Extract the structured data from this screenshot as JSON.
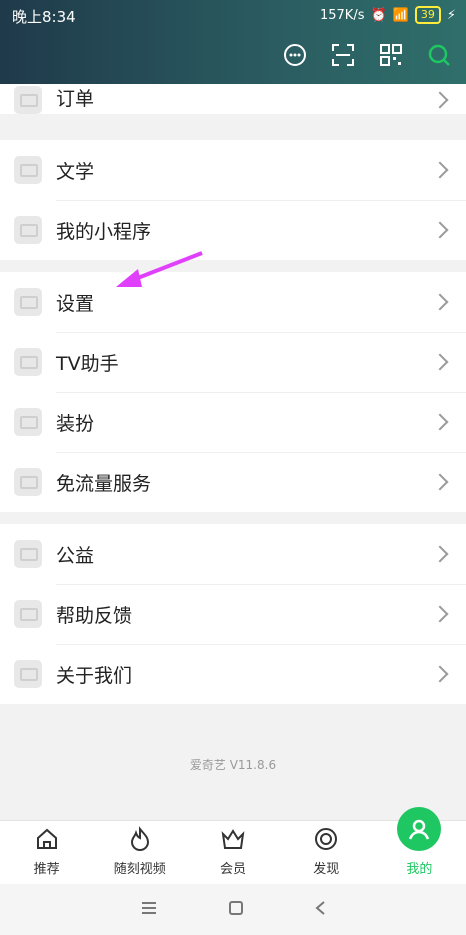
{
  "status": {
    "time": "晚上8:34",
    "speed": "157K/s",
    "battery": "39"
  },
  "sections": [
    [
      {
        "label": "订单"
      }
    ],
    [
      {
        "label": "文学"
      },
      {
        "label": "我的小程序"
      }
    ],
    [
      {
        "label": "设置"
      },
      {
        "label": "TV助手"
      },
      {
        "label": "装扮"
      },
      {
        "label": "免流量服务"
      }
    ],
    [
      {
        "label": "公益"
      },
      {
        "label": "帮助反馈"
      },
      {
        "label": "关于我们"
      }
    ]
  ],
  "version": "爱奇艺 V11.8.6",
  "tabs": [
    {
      "label": "推荐",
      "icon": "home-icon"
    },
    {
      "label": "随刻视频",
      "icon": "flame-icon"
    },
    {
      "label": "会员",
      "icon": "crown-icon"
    },
    {
      "label": "发现",
      "icon": "discover-icon"
    },
    {
      "label": "我的",
      "icon": "profile-icon",
      "active": true
    }
  ],
  "colors": {
    "accent": "#1ec761",
    "annotation_arrow": "#e040fb"
  }
}
